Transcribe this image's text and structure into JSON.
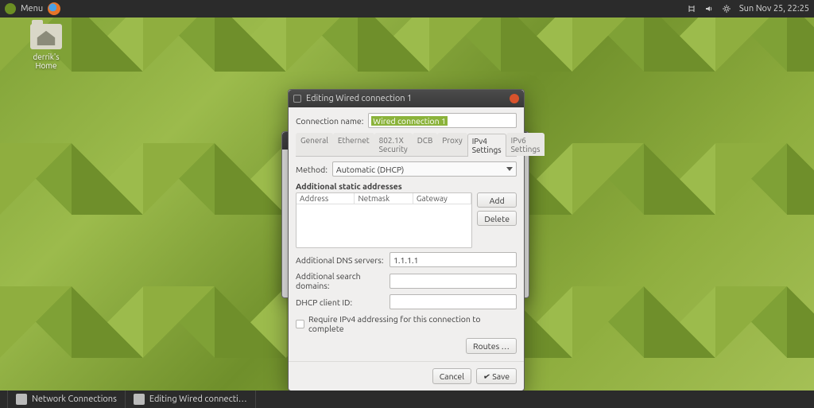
{
  "panel": {
    "menu_label": "Menu",
    "clock": "Sun Nov 25, 22:25"
  },
  "desktop": {
    "home_label": "derrik's Home"
  },
  "taskbar": {
    "item1": "Network Connections",
    "item2": "Editing Wired connecti…"
  },
  "dialog": {
    "title": "Editing Wired connection 1",
    "conn_name_label": "Connection name:",
    "conn_name_value": "Wired connection 1",
    "tabs": [
      "General",
      "Ethernet",
      "802.1X Security",
      "DCB",
      "Proxy",
      "IPv4 Settings",
      "IPv6 Settings"
    ],
    "active_tab": "IPv4 Settings",
    "method_label": "Method:",
    "method_value": "Automatic (DHCP)",
    "static_heading": "Additional static addresses",
    "cols": {
      "address": "Address",
      "netmask": "Netmask",
      "gateway": "Gateway"
    },
    "add_btn": "Add",
    "delete_btn": "Delete",
    "dns_label": "Additional DNS servers:",
    "dns_value": "1.1.1.1",
    "search_label": "Additional search domains:",
    "search_value": "",
    "dhcp_id_label": "DHCP client ID:",
    "dhcp_id_value": "",
    "require_label": "Require IPv4 addressing for this connection to complete",
    "routes_btn": "Routes …",
    "cancel_btn": "Cancel",
    "save_btn": "Save"
  }
}
